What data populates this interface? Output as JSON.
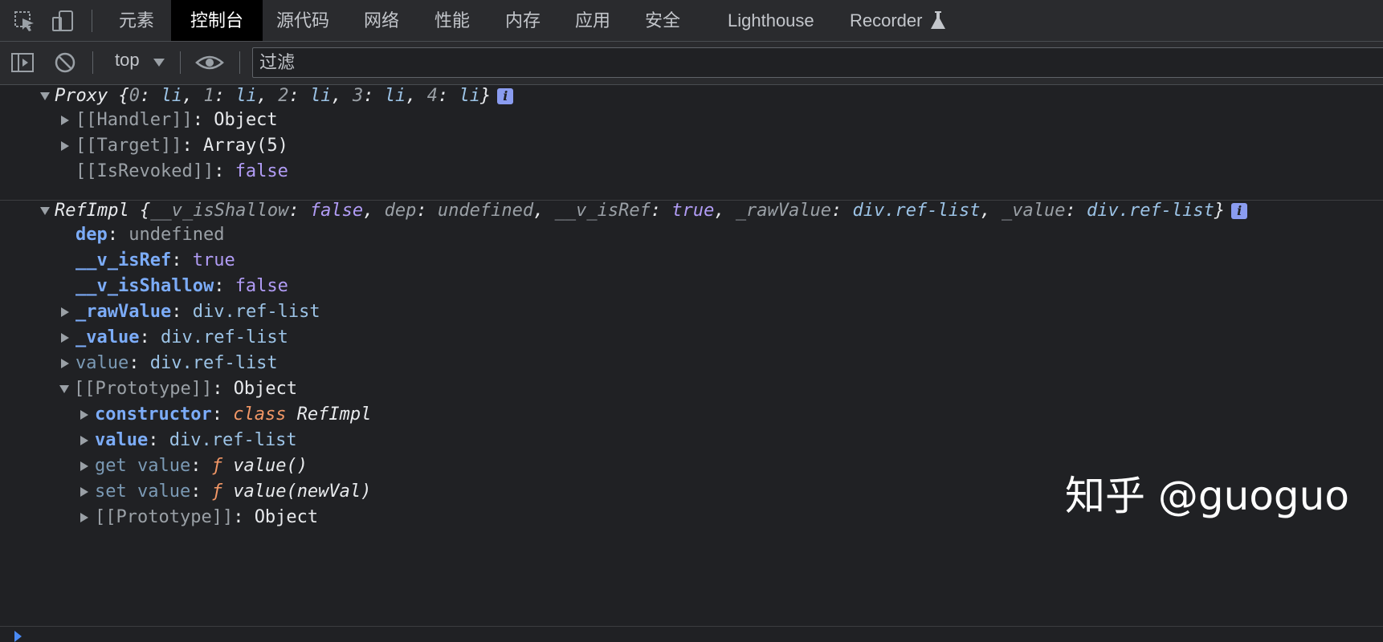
{
  "tabs": [
    "元素",
    "控制台",
    "源代码",
    "网络",
    "性能",
    "内存",
    "应用",
    "安全",
    "Lighthouse",
    "Recorder"
  ],
  "active_tab": "控制台",
  "toolbar": {
    "context": "top",
    "filter_placeholder": "过滤"
  },
  "proxy": {
    "head": "Proxy",
    "preview": [
      {
        "k": "0",
        "v": "li"
      },
      {
        "k": "1",
        "v": "li"
      },
      {
        "k": "2",
        "v": "li"
      },
      {
        "k": "3",
        "v": "li"
      },
      {
        "k": "4",
        "v": "li"
      }
    ],
    "handler_key": "[[Handler]]",
    "handler_val": "Object",
    "target_key": "[[Target]]",
    "target_val": "Array(5)",
    "revoked_key": "[[IsRevoked]]",
    "revoked_val": "false"
  },
  "refimpl": {
    "head": "RefImpl",
    "preview": [
      {
        "k": "__v_isShallow",
        "v": "false",
        "t": "bool"
      },
      {
        "k": "dep",
        "v": "undefined",
        "t": "undef"
      },
      {
        "k": "__v_isRef",
        "v": "true",
        "t": "bool"
      },
      {
        "k": "_rawValue",
        "v": "div.ref-list",
        "t": "str"
      },
      {
        "k": "_value",
        "v": "div.ref-list",
        "t": "str"
      }
    ],
    "dep": {
      "k": "dep",
      "v": "undefined"
    },
    "isRef": {
      "k": "__v_isRef",
      "v": "true"
    },
    "isShallow": {
      "k": "__v_isShallow",
      "v": "false"
    },
    "rawValue": {
      "k": "_rawValue",
      "v": "div.ref-list"
    },
    "value_": {
      "k": "_value",
      "v": "div.ref-list"
    },
    "value": {
      "k": "value",
      "v": "div.ref-list"
    },
    "proto": {
      "k": "[[Prototype]]",
      "v": "Object"
    },
    "ctor": {
      "k": "constructor",
      "kw": "class",
      "v": "RefImpl"
    },
    "pvalue": {
      "k": "value",
      "v": "div.ref-list"
    },
    "getter": {
      "k": "get value",
      "f": "ƒ",
      "v": "value()"
    },
    "setter": {
      "k": "set value",
      "f": "ƒ",
      "v": "value(newVal)"
    },
    "proto2": {
      "k": "[[Prototype]]",
      "v": "Object"
    }
  },
  "watermark": "知乎 @guoguo"
}
